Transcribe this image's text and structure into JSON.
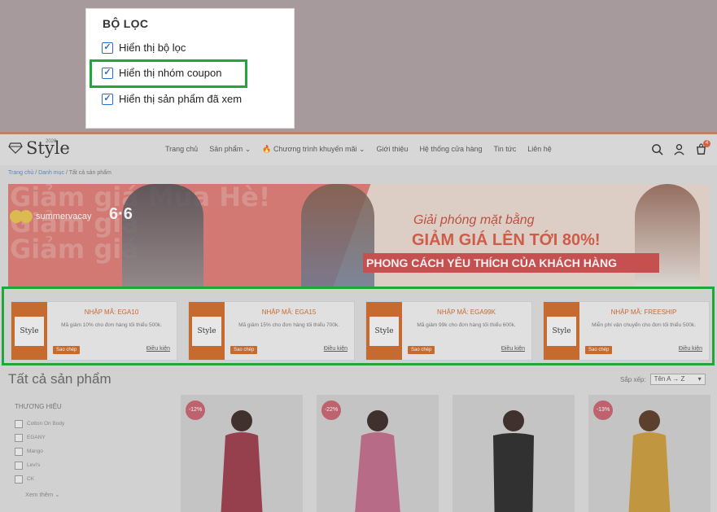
{
  "filter_panel": {
    "title": "BỘ LỌC",
    "options": [
      {
        "label": "Hiển thị bộ lọc",
        "checked": true
      },
      {
        "label": "Hiển thị nhóm coupon",
        "checked": true
      },
      {
        "label": "Hiển thị sản phẩm đã xem",
        "checked": true
      }
    ]
  },
  "site": {
    "logo": {
      "text": "Style",
      "since": "2020"
    },
    "nav": [
      "Trang chủ",
      "Sản phẩm ⌄",
      "🔥 Chương trình khuyến mãi ⌄",
      "Giới thiệu",
      "Hệ thống cửa hàng",
      "Tin tức",
      "Liên hệ"
    ],
    "cart_count": "4",
    "breadcrumb": {
      "home": "Trang chủ",
      "sep1": " / ",
      "category": "Danh mục",
      "sep2": " / ",
      "current": "Tất cả sản phẩm"
    },
    "banner": {
      "bg_text": [
        "Giảm giá Mùa Hè!",
        "Giảm giá",
        "Giảm giá"
      ],
      "brand_name": "summervacay",
      "brand_date": "6·6",
      "line1": "Giải phóng mặt bằng",
      "line2": "GIẢM GIÁ LÊN TỚI 80%!",
      "line3": "PHONG CÁCH YÊU THÍCH CỦA KHÁCH HÀNG"
    },
    "coupons": [
      {
        "code": "NHẬP MÃ: EGA10",
        "desc": "Mã giảm 10% cho đơn hàng tối thiểu 500k.",
        "copy": "Sao chép",
        "terms": "Điều kiện"
      },
      {
        "code": "NHẬP MÃ: EGA15",
        "desc": "Mã giảm 15% cho đơn hàng tối thiểu 700k.",
        "copy": "Sao chép",
        "terms": "Điều kiện"
      },
      {
        "code": "NHẬP MÃ: EGA99K",
        "desc": "Mã giảm 99k cho đơn hàng tối thiểu 600k.",
        "copy": "Sao chép",
        "terms": "Điều kiện"
      },
      {
        "code": "NHẬP MÃ: FREESHIP",
        "desc": "Miễn phí vận chuyển cho đơn tối thiểu 500k.",
        "copy": "Sao chép",
        "terms": "Điều kiện"
      }
    ],
    "coupon_logo": "Style",
    "all_products_title": "Tất cả sản phẩm",
    "sort": {
      "label": "Sắp xếp:",
      "value": "Tên A → Z"
    },
    "brand_filter": {
      "heading": "THƯƠNG HIỆU",
      "items": [
        "Cotton On Body",
        "EGANY",
        "Mango",
        "Levi's",
        "CK"
      ],
      "more": "Xem thêm ⌄"
    },
    "products": [
      {
        "discount": "-12%",
        "color": "#9a3a4a"
      },
      {
        "discount": "-22%",
        "color": "#c06a8a"
      },
      {
        "discount": "",
        "color": "#2a2a2a"
      },
      {
        "discount": "-13%",
        "color": "#c99a3a"
      }
    ]
  }
}
